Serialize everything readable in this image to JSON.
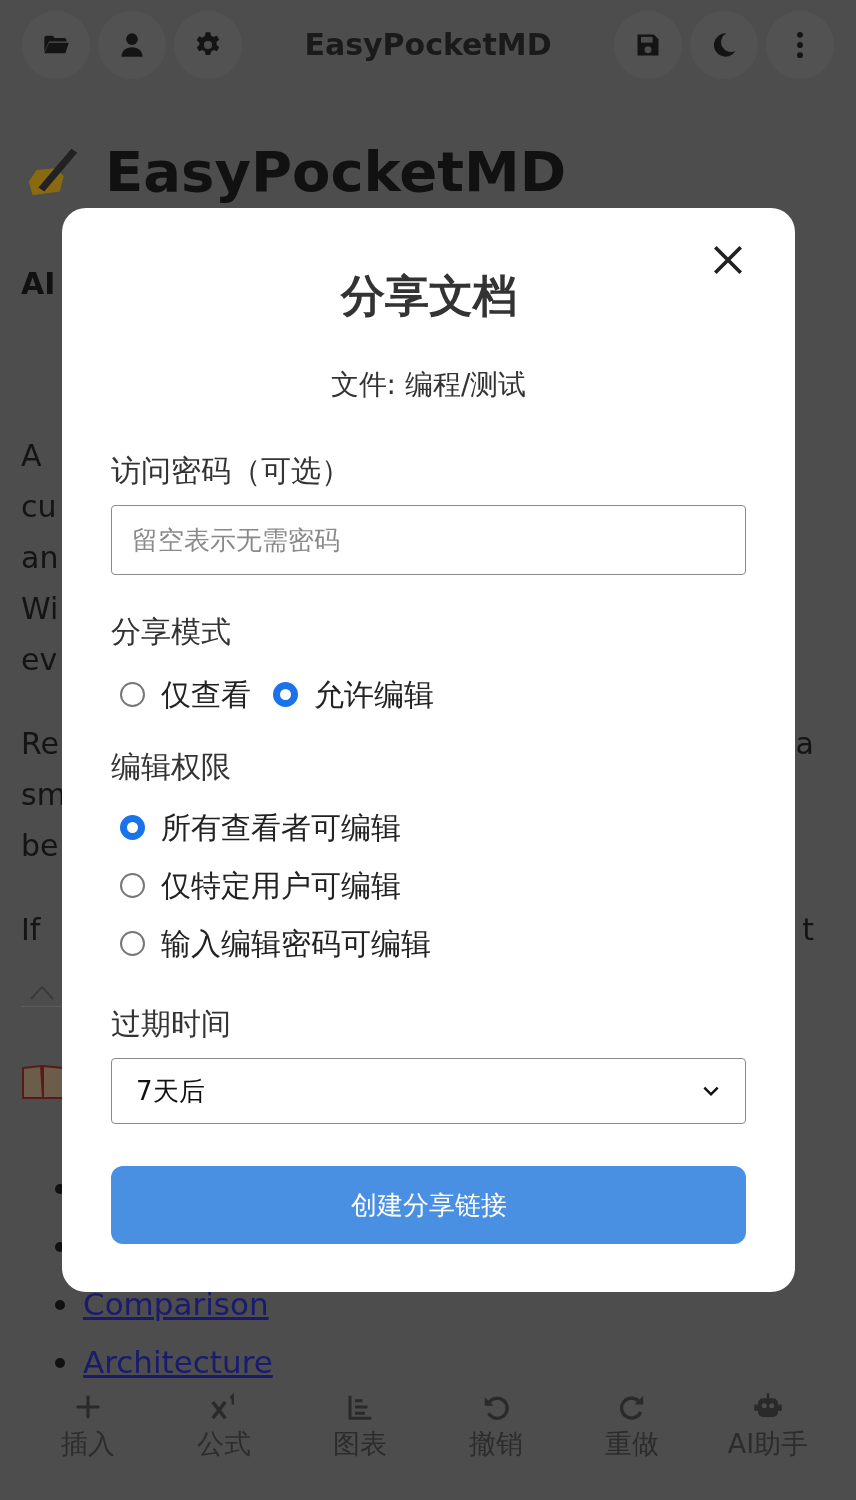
{
  "top_bar": {
    "title": "EasyPocketMD",
    "left_icons": [
      {
        "kind": "folder"
      },
      {
        "kind": "user"
      },
      {
        "kind": "settings"
      }
    ],
    "right_icons": [
      {
        "kind": "save"
      },
      {
        "kind": "moon"
      },
      {
        "kind": "more"
      }
    ]
  },
  "document": {
    "heading": "EasyPocketMD",
    "subheading": "AI",
    "paragraphs": [
      [
        {
          "left": "A"
        },
        {
          "left": "cu"
        },
        {
          "left": "an"
        },
        {
          "left": "Wi"
        },
        {
          "left": "ev"
        }
      ],
      [
        {
          "left": "Re",
          "right": "a"
        },
        {
          "left": "sm"
        },
        {
          "left": "be"
        }
      ],
      [
        {
          "left": "If",
          "right": "t"
        }
      ]
    ],
    "links": [
      "Comparison",
      "Architecture"
    ]
  },
  "share_dialog": {
    "title": "分享文档",
    "file_label": "文件: 编程/测试",
    "password": {
      "label": "访问密码（可选）",
      "placeholder": "留空表示无需密码"
    },
    "mode": {
      "label": "分享模式",
      "options": [
        {
          "label": "仅查看",
          "selected": false
        },
        {
          "label": "允许编辑",
          "selected": true
        }
      ]
    },
    "permission": {
      "label": "编辑权限",
      "options": [
        {
          "label": "所有查看者可编辑",
          "selected": true
        },
        {
          "label": "仅特定用户可编辑",
          "selected": false
        },
        {
          "label": "输入编辑密码可编辑",
          "selected": false
        }
      ]
    },
    "expiry": {
      "label": "过期时间",
      "value": "7天后"
    },
    "submit": "创建分享链接"
  },
  "bottom_toolbar": [
    {
      "kind": "insert",
      "label": "插入"
    },
    {
      "kind": "formula",
      "label": "公式"
    },
    {
      "kind": "chart",
      "label": "图表"
    },
    {
      "kind": "undo",
      "label": "撤销"
    },
    {
      "kind": "redo",
      "label": "重做"
    },
    {
      "kind": "ai",
      "label": "AI助手"
    }
  ]
}
